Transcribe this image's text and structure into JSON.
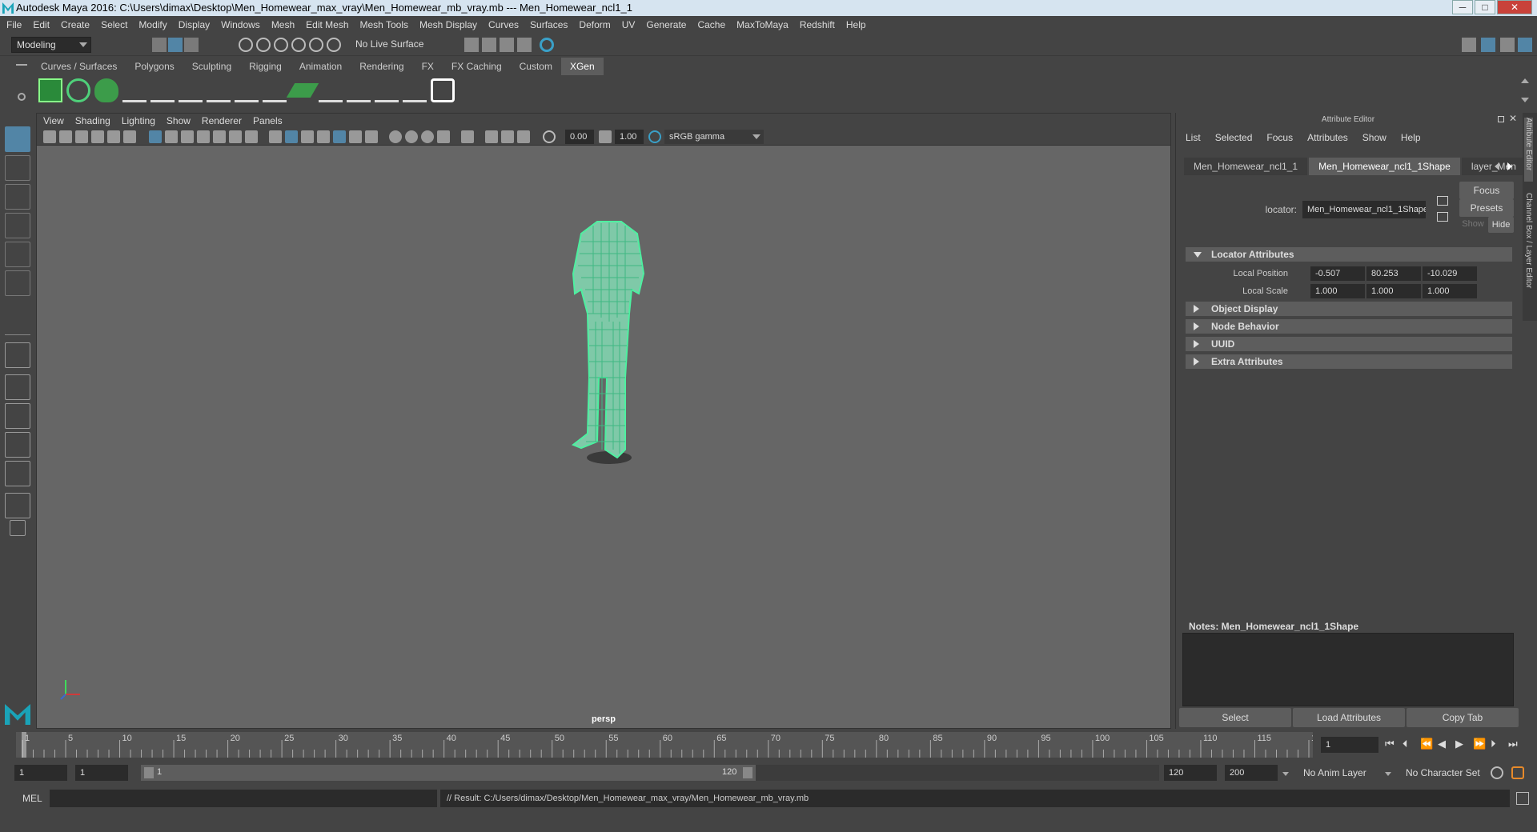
{
  "window": {
    "title": "Autodesk Maya 2016: C:\\Users\\dimax\\Desktop\\Men_Homewear_max_vray\\Men_Homewear_mb_vray.mb   ---   Men_Homewear_ncl1_1",
    "min": "─",
    "max": "□",
    "close": "✕"
  },
  "menubar": [
    "File",
    "Edit",
    "Create",
    "Select",
    "Modify",
    "Display",
    "Windows",
    "Mesh",
    "Edit Mesh",
    "Mesh Tools",
    "Mesh Display",
    "Curves",
    "Surfaces",
    "Deform",
    "UV",
    "Generate",
    "Cache",
    "MaxToMaya",
    "Redshift",
    "Help"
  ],
  "status": {
    "mode": "Modeling",
    "live_surface": "No Live Surface"
  },
  "shelf": {
    "tabs": [
      "Curves / Surfaces",
      "Polygons",
      "Sculpting",
      "Rigging",
      "Animation",
      "Rendering",
      "FX",
      "FX Caching",
      "Custom",
      "XGen"
    ],
    "active_tab": "XGen"
  },
  "viewport": {
    "menu": [
      "View",
      "Shading",
      "Lighting",
      "Show",
      "Renderer",
      "Panels"
    ],
    "exposure": "0.00",
    "gamma": "1.00",
    "colorspace": "sRGB gamma",
    "camera_label": "persp"
  },
  "attribute_editor": {
    "title": "Attribute Editor",
    "menu": [
      "List",
      "Selected",
      "Focus",
      "Attributes",
      "Show",
      "Help"
    ],
    "tabs": [
      "Men_Homewear_ncl1_1",
      "Men_Homewear_ncl1_1Shape",
      "layer_Men"
    ],
    "active_tab": "Men_Homewear_ncl1_1Shape",
    "node_type_label": "locator:",
    "node_name": "Men_Homewear_ncl1_1Shape",
    "buttons": {
      "focus": "Focus",
      "presets": "Presets",
      "show": "Show",
      "hide": "Hide"
    },
    "sections": {
      "locator": "Locator Attributes",
      "object_display": "Object Display",
      "node_behavior": "Node Behavior",
      "uuid": "UUID",
      "extra": "Extra Attributes"
    },
    "local_position_label": "Local Position",
    "local_position": [
      "-0.507",
      "80.253",
      "-10.029"
    ],
    "local_scale_label": "Local Scale",
    "local_scale": [
      "1.000",
      "1.000",
      "1.000"
    ],
    "notes_label": "Notes:  Men_Homewear_ncl1_1Shape",
    "bottom_buttons": [
      "Select",
      "Load Attributes",
      "Copy Tab"
    ],
    "side_tabs": [
      "Attribute Editor",
      "Channel Box / Layer Editor"
    ]
  },
  "timeline": {
    "ticks": [
      "1",
      "5",
      "10",
      "15",
      "20",
      "25",
      "30",
      "35",
      "40",
      "45",
      "50",
      "55",
      "60",
      "65",
      "70",
      "75",
      "80",
      "85",
      "90",
      "95",
      "100",
      "105",
      "110",
      "115",
      "120"
    ],
    "current_frame": "1"
  },
  "range": {
    "start": "1",
    "anim_start": "1",
    "slider_start": "1",
    "slider_end": "120",
    "end": "120",
    "anim_end": "200",
    "anim_layer": "No Anim Layer",
    "char_set": "No Character Set"
  },
  "command": {
    "language": "MEL",
    "result": "// Result: C:/Users/dimax/Desktop/Men_Homewear_max_vray/Men_Homewear_mb_vray.mb"
  },
  "colors": {
    "accent": "#5285a6",
    "wire": "#4df0a0",
    "bg": "#444444",
    "viewport": "#666666"
  }
}
